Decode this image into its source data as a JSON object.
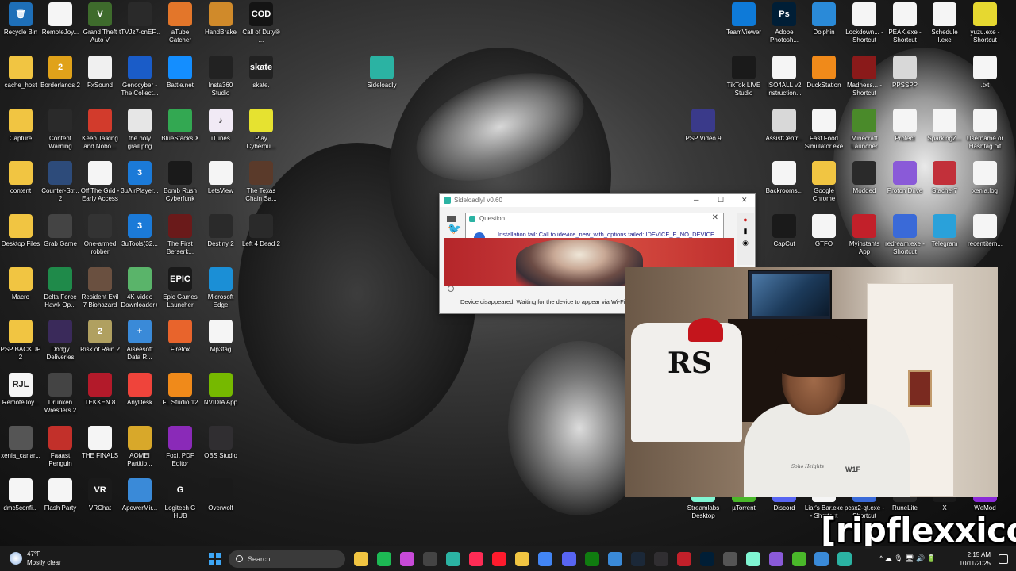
{
  "desktop": {
    "icons": [
      {
        "label": "Recycle Bin",
        "glyph": "🗑",
        "color": "#1e6fb8"
      },
      {
        "label": "RemoteJoy...",
        "glyph": "",
        "color": "#f5f5f5"
      },
      {
        "label": "Grand Theft Auto V",
        "glyph": "V",
        "color": "#3e6b2c"
      },
      {
        "label": "tTVJz7-cnEF...",
        "glyph": "",
        "color": "#2a2a2a"
      },
      {
        "label": "aTube Catcher",
        "glyph": "",
        "color": "#e3762a"
      },
      {
        "label": "HandBrake",
        "glyph": "",
        "color": "#d08a2a"
      },
      {
        "label": "Call of Duty® ...",
        "glyph": "COD",
        "color": "#141414"
      },
      {
        "label": "cache_host",
        "glyph": "",
        "color": "#f1c542"
      },
      {
        "label": "Borderlands 2",
        "glyph": "2",
        "color": "#e0a21a"
      },
      {
        "label": "FxSound",
        "glyph": "",
        "color": "#f0f0f0"
      },
      {
        "label": "Genocyber - The Collect...",
        "glyph": "",
        "color": "#1a5cc8"
      },
      {
        "label": "Battle.net",
        "glyph": "",
        "color": "#148eff"
      },
      {
        "label": "Insta360 Studio",
        "glyph": "",
        "color": "#222"
      },
      {
        "label": "skate.",
        "glyph": "skate",
        "color": "#222"
      },
      {
        "label": "Sideloadly",
        "glyph": "",
        "color": "#2bb3a3"
      },
      {
        "label": "Capture",
        "glyph": "",
        "color": "#f1c542"
      },
      {
        "label": "Content Warning",
        "glyph": "",
        "color": "#2a2a2a"
      },
      {
        "label": "Keep Talking and Nobo...",
        "glyph": "",
        "color": "#d23b2c"
      },
      {
        "label": "the holy grail.png",
        "glyph": "",
        "color": "#e6e6e6"
      },
      {
        "label": "BlueStacks X",
        "glyph": "",
        "color": "#33a852"
      },
      {
        "label": "iTunes",
        "glyph": "♪",
        "color": "#f1eaf5"
      },
      {
        "label": "Play Cyberpu...",
        "glyph": "",
        "color": "#e6e230"
      },
      {
        "label": "content",
        "glyph": "",
        "color": "#f1c542"
      },
      {
        "label": "Counter-Str... 2",
        "glyph": "",
        "color": "#2d4b7a"
      },
      {
        "label": "Off The Grid - Early Access",
        "glyph": "",
        "color": "#f5f5f5"
      },
      {
        "label": "3uAirPlayer...",
        "glyph": "3",
        "color": "#1b7ad8"
      },
      {
        "label": "Bomb Rush Cyberfunk",
        "glyph": "",
        "color": "#1a1a1a"
      },
      {
        "label": "LetsView",
        "glyph": "",
        "color": "#f5f5f5"
      },
      {
        "label": "The Texas Chain Sa...",
        "glyph": "",
        "color": "#5a3a2a"
      },
      {
        "label": "Desktop Files",
        "glyph": "",
        "color": "#f1c542"
      },
      {
        "label": "Grab Game",
        "glyph": "",
        "color": "#444"
      },
      {
        "label": "One-armed robber",
        "glyph": "",
        "color": "#333"
      },
      {
        "label": "3uTools(32...",
        "glyph": "3",
        "color": "#1b7ad8"
      },
      {
        "label": "The First Berserk...",
        "glyph": "",
        "color": "#6a1a1a"
      },
      {
        "label": "Destiny 2",
        "glyph": "",
        "color": "#2a2a2a"
      },
      {
        "label": "Left 4 Dead 2",
        "glyph": "",
        "color": "#2a2a2a"
      },
      {
        "label": "Macro",
        "glyph": "",
        "color": "#f1c542"
      },
      {
        "label": "Delta Force Hawk Op...",
        "glyph": "",
        "color": "#1f8a4a"
      },
      {
        "label": "Resident Evil 7 Biohazard",
        "glyph": "",
        "color": "#6a5040"
      },
      {
        "label": "4K Video Downloader+",
        "glyph": "",
        "color": "#5ab46a"
      },
      {
        "label": "Epic Games Launcher",
        "glyph": "EPIC",
        "color": "#1a1a1a"
      },
      {
        "label": "Microsoft Edge",
        "glyph": "",
        "color": "#1b8fd6"
      },
      {
        "label": "PSP BACKUP 2",
        "glyph": "",
        "color": "#f1c542"
      },
      {
        "label": "Dodgy Deliveries",
        "glyph": "",
        "color": "#3a2a5a"
      },
      {
        "label": "Risk of Rain 2",
        "glyph": "2",
        "color": "#b0a060"
      },
      {
        "label": "Aiseesoft Data R...",
        "glyph": "+",
        "color": "#3a8ad8"
      },
      {
        "label": "Firefox",
        "glyph": "",
        "color": "#e8642c"
      },
      {
        "label": "Mp3tag",
        "glyph": "",
        "color": "#f5f5f5"
      },
      {
        "label": "RemoteJoy...",
        "glyph": "RJL",
        "color": "#f5f5f5"
      },
      {
        "label": "Drunken Wrestlers 2",
        "glyph": "",
        "color": "#444"
      },
      {
        "label": "TEKKEN 8",
        "glyph": "",
        "color": "#b31a2a"
      },
      {
        "label": "AnyDesk",
        "glyph": "",
        "color": "#ef443b"
      },
      {
        "label": "FL Studio 12",
        "glyph": "",
        "color": "#f08a1a"
      },
      {
        "label": "NVIDIA App",
        "glyph": "",
        "color": "#76b900"
      },
      {
        "label": "xenia_canar...",
        "glyph": "",
        "color": "#555"
      },
      {
        "label": "Faaast Penguin",
        "glyph": "",
        "color": "#c2302a"
      },
      {
        "label": "THE FINALS",
        "glyph": "",
        "color": "#f5f5f5"
      },
      {
        "label": "AOMEI Partitio...",
        "glyph": "",
        "color": "#d8a82a"
      },
      {
        "label": "Foxit PDF Editor",
        "glyph": "",
        "color": "#8a2ab8"
      },
      {
        "label": "OBS Studio",
        "glyph": "",
        "color": "#302e31"
      },
      {
        "label": "dmc5confi...",
        "glyph": "",
        "color": "#f5f5f5"
      },
      {
        "label": "Flash Party",
        "glyph": "",
        "color": "#f5f5f5"
      },
      {
        "label": "VRChat",
        "glyph": "VR",
        "color": "#1a1a1a"
      },
      {
        "label": "ApowerMir...",
        "glyph": "",
        "color": "#3a8ad8"
      },
      {
        "label": "Logitech G HUB",
        "glyph": "G",
        "color": "#1a1a1a"
      },
      {
        "label": "Overwolf",
        "glyph": "",
        "color": "#1a1a1a"
      },
      {
        "label": "TeamViewer",
        "glyph": "",
        "color": "#0e7ad8"
      },
      {
        "label": "Adobe Photosh...",
        "glyph": "Ps",
        "color": "#001e36"
      },
      {
        "label": "Dolphin",
        "glyph": "",
        "color": "#2a8ad8"
      },
      {
        "label": "Lockdown... - Shortcut",
        "glyph": "",
        "color": "#f5f5f5"
      },
      {
        "label": "PEAK.exe - Shortcut",
        "glyph": "",
        "color": "#f5f5f5"
      },
      {
        "label": "Schedule I.exe",
        "glyph": "",
        "color": "#f5f5f5"
      },
      {
        "label": "yuzu.exe - Shortcut",
        "glyph": "",
        "color": "#e6d830"
      },
      {
        "label": "TikTok LIVE Studio",
        "glyph": "",
        "color": "#1a1a1a"
      },
      {
        "label": "ISO4ALL v2 Instruction...",
        "glyph": "",
        "color": "#f5f5f5"
      },
      {
        "label": "DuckStation",
        "glyph": "",
        "color": "#f08a1a"
      },
      {
        "label": "Madness... - Shortcut",
        "glyph": "",
        "color": "#8a1a1a"
      },
      {
        "label": "PPSSPP",
        "glyph": "",
        "color": "#d8d8d8"
      },
      {
        "label": ".txt",
        "glyph": "",
        "color": "#f5f5f5"
      },
      {
        "label": "PSP Video 9",
        "glyph": "",
        "color": "#3a3a8a"
      },
      {
        "label": "AssistCentr...",
        "glyph": "",
        "color": "#d8d8d8"
      },
      {
        "label": "Fast Food Simulator.exe",
        "glyph": "",
        "color": "#f5f5f5"
      },
      {
        "label": "Minecraft Launcher",
        "glyph": "",
        "color": "#4a8a2a"
      },
      {
        "label": "Protect",
        "glyph": "",
        "color": "#f5f5f5"
      },
      {
        "label": "SparkingZ...",
        "glyph": "",
        "color": "#f5f5f5"
      },
      {
        "label": "Username or Hashtag.txt",
        "glyph": "",
        "color": "#f5f5f5"
      },
      {
        "label": "Backrooms...",
        "glyph": "",
        "color": "#f5f5f5"
      },
      {
        "label": "Google Chrome",
        "glyph": "",
        "color": "#f1c542"
      },
      {
        "label": "Modded",
        "glyph": "",
        "color": "#2a2a2a"
      },
      {
        "label": "Proton Drive",
        "glyph": "",
        "color": "#8a5ad8"
      },
      {
        "label": "Stacher7",
        "glyph": "",
        "color": "#c2303a"
      },
      {
        "label": "xenia.log",
        "glyph": "",
        "color": "#f5f5f5"
      },
      {
        "label": "CapCut",
        "glyph": "",
        "color": "#1a1a1a"
      },
      {
        "label": "GTFO",
        "glyph": "",
        "color": "#f5f5f5"
      },
      {
        "label": "Myinstants App",
        "glyph": "",
        "color": "#c2202a"
      },
      {
        "label": "redream.exe - Shortcut",
        "glyph": "",
        "color": "#3a6ad8"
      },
      {
        "label": "Telegram",
        "glyph": "",
        "color": "#2aa1da"
      },
      {
        "label": "recentitem...",
        "glyph": "",
        "color": "#f5f5f5"
      },
      {
        "label": "Streamlabs Desktop",
        "glyph": "",
        "color": "#80f5d2"
      },
      {
        "label": "µTorrent",
        "glyph": "",
        "color": "#4ab82a"
      },
      {
        "label": "Discord",
        "glyph": "",
        "color": "#5865f2"
      },
      {
        "label": "Liar's Bar.exe - Shortcut",
        "glyph": "",
        "color": "#f5f5f5"
      },
      {
        "label": "pcsx2-qt.exe - Shortcut",
        "glyph": "",
        "color": "#3a6ad8"
      },
      {
        "label": "RuneLite",
        "glyph": "",
        "color": "#2a2a2a"
      },
      {
        "label": "X",
        "glyph": "X",
        "color": "#1a1a1a"
      },
      {
        "label": "WeMod",
        "glyph": "",
        "color": "#8a2ad8"
      }
    ]
  },
  "sideloadly": {
    "title": "Sideloadly! v0.60",
    "status": "Device disappeared. Waiting for the device to appear via Wi-Fi or"
  },
  "question_dialog": {
    "title": "Question",
    "message": "Installation fail: Call to idevice_new_with_options failed: IDEVICE_E_NO_DEVICE."
  },
  "webcam": {
    "shirt_text": "RS",
    "hoodie_text": "W1F",
    "hoodie_script": "Soho Heights"
  },
  "watermark": "[ripflexxico]",
  "taskbar": {
    "weather_temp": "47°F",
    "weather_desc": "Mostly clear",
    "search_label": "Search",
    "time": "2:15 AM",
    "date": "10/11/2025",
    "apps": [
      {
        "name": "file-explorer-taskbar",
        "color": "#f1c542"
      },
      {
        "name": "spotify-taskbar",
        "color": "#1db954"
      },
      {
        "name": "copilot-taskbar",
        "color": "#c84ad8"
      },
      {
        "name": "terminal-taskbar",
        "color": "#444"
      },
      {
        "name": "sideloadly-taskbar",
        "color": "#2bb3a3"
      },
      {
        "name": "tiktok-taskbar",
        "color": "#fe2c55"
      },
      {
        "name": "opera-taskbar",
        "color": "#ff1b2d"
      },
      {
        "name": "folder-taskbar",
        "color": "#f1c542"
      },
      {
        "name": "chrome-taskbar",
        "color": "#4285f4"
      },
      {
        "name": "discord-taskbar",
        "color": "#5865f2"
      },
      {
        "name": "xbox-taskbar",
        "color": "#107c10"
      },
      {
        "name": "teams-taskbar",
        "color": "#3a8ad8"
      },
      {
        "name": "steam-taskbar",
        "color": "#1b2838"
      },
      {
        "name": "obs-taskbar",
        "color": "#302e31"
      },
      {
        "name": "record-taskbar",
        "color": "#c2202a"
      },
      {
        "name": "photoshop-taskbar",
        "color": "#001e36"
      },
      {
        "name": "overwolf-taskbar",
        "color": "#555"
      },
      {
        "name": "streamlabs-taskbar",
        "color": "#80f5d2"
      },
      {
        "name": "proton-taskbar",
        "color": "#8a5ad8"
      },
      {
        "name": "green-app-taskbar",
        "color": "#4ab82a"
      },
      {
        "name": "chat-taskbar",
        "color": "#3a8ad8"
      },
      {
        "name": "sideloadly2-taskbar",
        "color": "#2bb3a3"
      }
    ],
    "tray_text": "^  ☁  🎙  🖥  🔊  🔋"
  }
}
